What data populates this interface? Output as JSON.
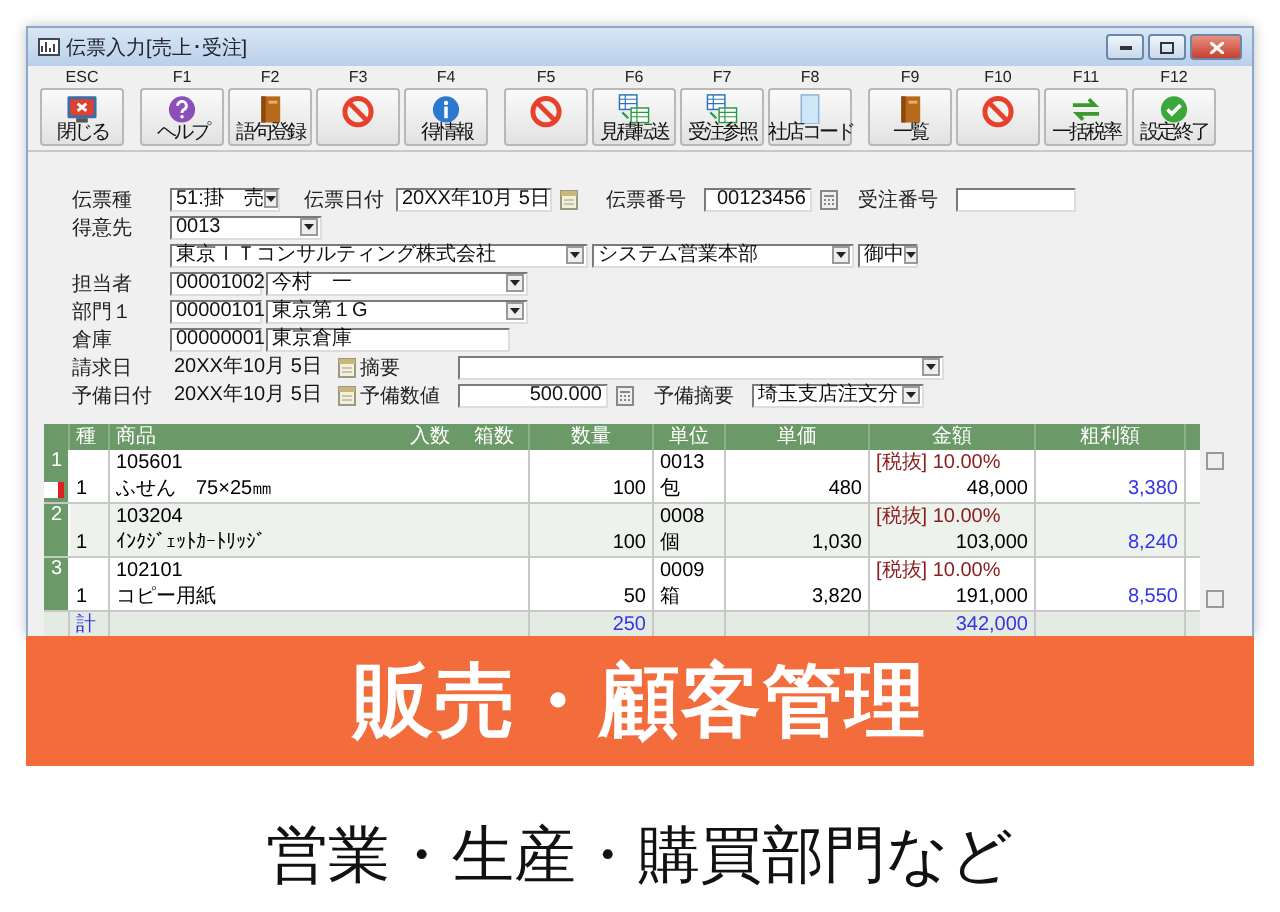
{
  "window": {
    "title": "伝票入力[売上･受注]"
  },
  "toolbar": [
    {
      "key": "ESC",
      "label": "閉じる",
      "kind": "close"
    },
    {
      "key": "F1",
      "label": "ヘルプ",
      "kind": "help"
    },
    {
      "key": "F2",
      "label": "語句登録",
      "kind": "book"
    },
    {
      "key": "F3",
      "kind": "prohibit"
    },
    {
      "key": "F4",
      "label": "得情報",
      "kind": "info"
    },
    {
      "key": "F5",
      "kind": "prohibit"
    },
    {
      "key": "F6",
      "label": "見積転送",
      "kind": "sheets"
    },
    {
      "key": "F7",
      "label": "受注参照",
      "kind": "sheets"
    },
    {
      "key": "F8",
      "label": "社店コード",
      "kind": "card"
    },
    {
      "key": "F9",
      "label": "一覧",
      "kind": "book"
    },
    {
      "key": "F10",
      "kind": "prohibit"
    },
    {
      "key": "F11",
      "label": "一括税率",
      "kind": "arrows"
    },
    {
      "key": "F12",
      "label": "設定終了",
      "kind": "check"
    }
  ],
  "form": {
    "slip_type": {
      "label": "伝票種",
      "value": "51:掛　売"
    },
    "slip_date": {
      "label": "伝票日付",
      "value": "20XX年10月 5日"
    },
    "slip_number": {
      "label": "伝票番号",
      "value": "00123456"
    },
    "order_number": {
      "label": "受注番号"
    },
    "customer": {
      "label": "得意先",
      "code": "0013",
      "name": "東京ＩＴコンサルティング株式会社",
      "department": "システム営業本部",
      "honorific": "御中"
    },
    "staff": {
      "label": "担当者",
      "code": "00001002",
      "name": "今村　一"
    },
    "division": {
      "label": "部門１",
      "code": "00000101",
      "name": "東京第１G"
    },
    "warehouse": {
      "label": "倉庫",
      "code": "00000001",
      "name": "東京倉庫"
    },
    "billing_date": {
      "label": "請求日",
      "value": "20XX年10月 5日"
    },
    "memo": {
      "label": "摘要"
    },
    "spare_date": {
      "label": "予備日付",
      "value": "20XX年10月 5日"
    },
    "spare_number": {
      "label": "予備数値",
      "value": "500.000"
    },
    "spare_memo": {
      "label": "予備摘要",
      "value": "埼玉支店注文分"
    }
  },
  "grid": {
    "columns": [
      "種",
      "商品",
      "入数",
      "箱数",
      "数量",
      "単位",
      "単価",
      "金額",
      "粗利額"
    ],
    "rows": [
      {
        "number": "1",
        "current": true,
        "col_type": "1",
        "code": "105601",
        "name": "ふせん　75×25㎜",
        "quantity": "100",
        "unit_code": "0013",
        "unit": "包",
        "price": "480",
        "tax": "[税抜] 10.00%",
        "amount": "48,000",
        "profit": "3,380"
      },
      {
        "number": "2",
        "current": false,
        "col_type": "1",
        "code": "103204",
        "name": "ｲﾝｸｼﾞｪｯﾄｶｰﾄﾘｯｼﾞ",
        "quantity": "100",
        "unit_code": "0008",
        "unit": "個",
        "price": "1,030",
        "tax": "[税抜] 10.00%",
        "amount": "103,000",
        "profit": "8,240"
      },
      {
        "number": "3",
        "current": false,
        "col_type": "1",
        "code": "102101",
        "name": "コピー用紙",
        "quantity": "50",
        "unit_code": "0009",
        "unit": "箱",
        "price": "3,820",
        "tax": "[税抜] 10.00%",
        "amount": "191,000",
        "profit": "8,550"
      }
    ],
    "total": {
      "label": "計",
      "quantity": "250",
      "amount": "342,000"
    }
  },
  "banner": {
    "title": "販売・顧客管理"
  },
  "caption": "営業・生産・購買部門など"
}
